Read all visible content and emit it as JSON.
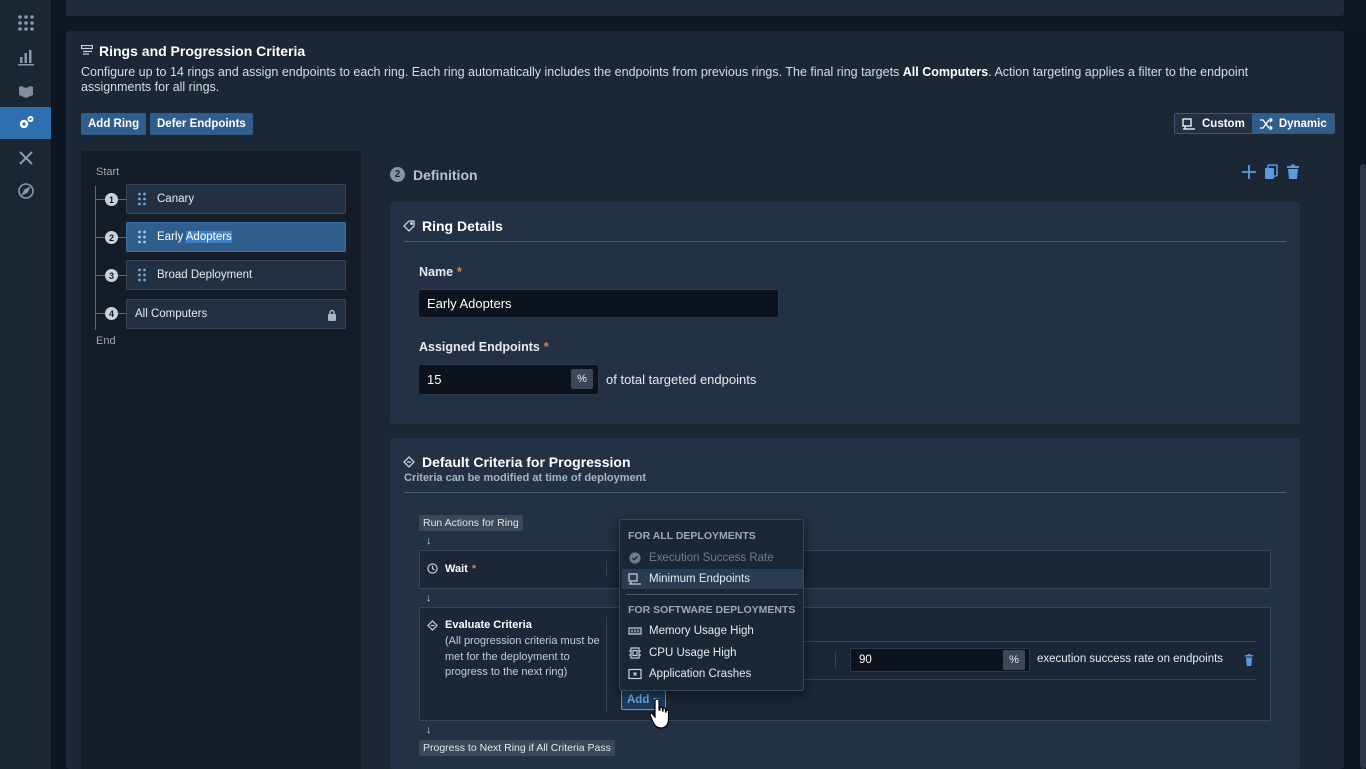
{
  "nav": {
    "items": [
      {
        "icon": "apps-grid-icon",
        "active": false
      },
      {
        "icon": "bar-chart-icon",
        "active": false
      },
      {
        "icon": "stack-icon",
        "active": false
      },
      {
        "icon": "gears-icon",
        "active": true
      },
      {
        "icon": "tools-icon",
        "active": false
      },
      {
        "icon": "compass-icon",
        "active": false
      }
    ]
  },
  "header": {
    "title": "Rings and Progression Criteria",
    "description_part1": "Configure up to 14 rings and assign endpoints to each ring. Each ring automatically includes the endpoints from previous rings. The final ring targets ",
    "description_bold": "All Computers",
    "description_part2": ". Action targeting applies a filter to the endpoint assignments for all rings."
  },
  "toolbar": {
    "add_ring": "Add Ring",
    "defer_endpoints": "Defer Endpoints",
    "custom": "Custom",
    "dynamic": "Dynamic"
  },
  "ring_list": {
    "start_label": "Start",
    "end_label": "End",
    "rings": [
      {
        "num": "1",
        "name": "Canary"
      },
      {
        "num": "2",
        "name_plain": "Early ",
        "name_highlight": "Adopters"
      },
      {
        "num": "3",
        "name": "Broad Deployment"
      },
      {
        "num": "4",
        "name": "All Computers"
      }
    ]
  },
  "definition": {
    "step": "2",
    "title": "Definition"
  },
  "ring_details": {
    "title": "Ring Details",
    "name_label": "Name",
    "required_mark": "*",
    "name_value": "Early Adopters",
    "assigned_label": "Assigned Endpoints",
    "assigned_value": "15",
    "percent_unit": "%",
    "assigned_suffix": "of total targeted endpoints"
  },
  "criteria": {
    "title": "Default Criteria for Progression",
    "subtitle": "Criteria can be modified at time of deployment",
    "run_actions": "Run Actions for Ring",
    "arrow": "↓",
    "wait_label": "Wait",
    "evaluate_label": "Evaluate Criteria",
    "evaluate_desc": "(All progression criteria must be met for the deployment to progress to the next ring)",
    "criterion_value": "90",
    "criterion_unit": "%",
    "criterion_text": "execution success rate on endpoints",
    "add_label": "Add",
    "progress_label": "Progress to Next Ring if All Criteria Pass"
  },
  "add_menu": {
    "section1": "FOR ALL DEPLOYMENTS",
    "item_exec_success": "Execution Success Rate",
    "item_min_endpoints": "Minimum Endpoints",
    "section2": "FOR SOFTWARE DEPLOYMENTS",
    "item_memory": "Memory Usage High",
    "item_cpu": "CPU Usage High",
    "item_crashes": "Application Crashes"
  }
}
